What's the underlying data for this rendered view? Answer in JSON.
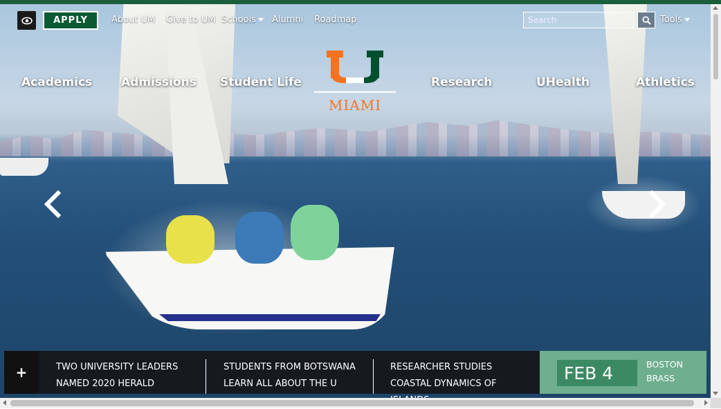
{
  "header": {
    "apply_label": "APPLY",
    "utility_links": [
      "About UM",
      "Give to UM",
      "Schools",
      "Alumni",
      "Roadmap"
    ],
    "search_placeholder": "Search",
    "tools_label": "Tools"
  },
  "main_nav": {
    "left": [
      "Academics",
      "Admissions",
      "Student Life"
    ],
    "right": [
      "Research",
      "UHealth",
      "Athletics"
    ]
  },
  "logo": {
    "text": "MIAMI",
    "colors": {
      "orange": "#f47321",
      "green": "#005030"
    }
  },
  "ticker": {
    "expand_label": "+",
    "stories": [
      "TWO UNIVERSITY LEADERS NAMED 2020 HERALD",
      "STUDENTS FROM BOTSWANA LEARN ALL ABOUT THE U",
      "RESEARCHER STUDIES COASTAL DYNAMICS OF ISLANDS"
    ],
    "event": {
      "date": "FEB 4",
      "title": "BOSTON BRASS"
    }
  },
  "colors": {
    "brand_green": "#0c5a34",
    "event_panel": "#6fae8f",
    "event_date_bg": "#3c8a63"
  },
  "icons": [
    "eye-icon",
    "search-icon",
    "chevron-left-icon",
    "chevron-right-icon",
    "caret-down-icon"
  ]
}
